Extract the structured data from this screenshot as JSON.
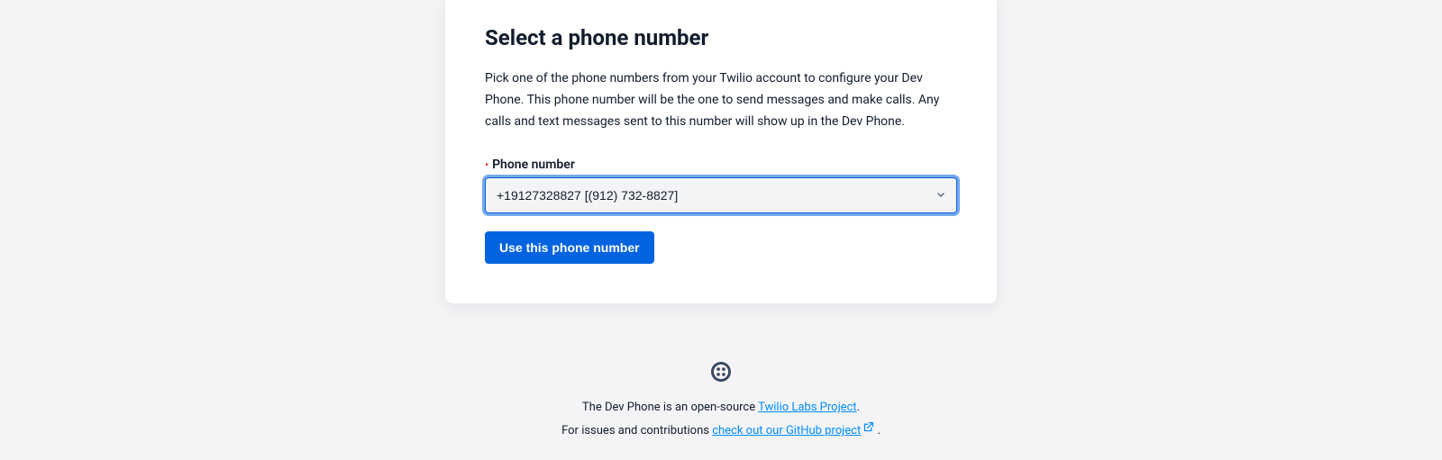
{
  "card": {
    "title": "Select a phone number",
    "description": "Pick one of the phone numbers from your Twilio account to configure your Dev Phone. This phone number will be the one to send messages and make calls. Any calls and text messages sent to this number will show up in the Dev Phone.",
    "field_label": "Phone number",
    "selected_value": "+19127328827 [(912) 732-8827]",
    "submit_label": "Use this phone number"
  },
  "footer": {
    "line1_prefix": "The Dev Phone is an open-source ",
    "line1_link": "Twilio Labs Project",
    "line1_suffix": ".",
    "line2_prefix": "For issues and contributions ",
    "line2_link": "check out our GitHub project",
    "line2_suffix": " ."
  }
}
